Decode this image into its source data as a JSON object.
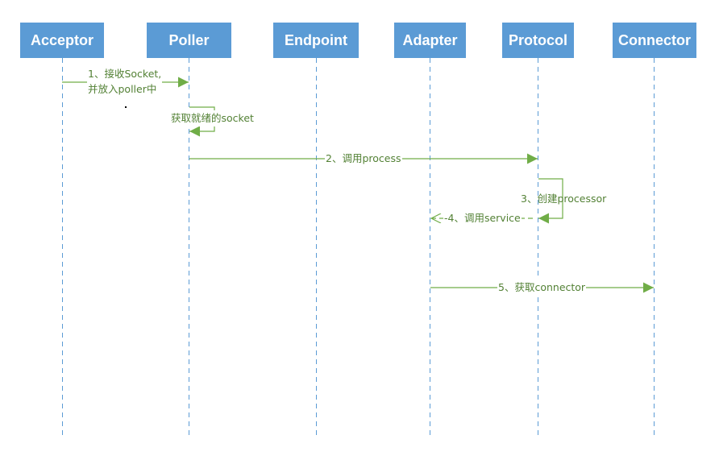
{
  "colors": {
    "box_fill": "#5b9bd5",
    "lifeline": "#5b9bd5",
    "message": "#70ad47",
    "label": "#538135"
  },
  "participants": [
    {
      "id": "acceptor",
      "label": "Acceptor"
    },
    {
      "id": "poller",
      "label": "Poller"
    },
    {
      "id": "endpoint",
      "label": "Endpoint"
    },
    {
      "id": "adapter",
      "label": "Adapter"
    },
    {
      "id": "protocol",
      "label": "Protocol"
    },
    {
      "id": "connector",
      "label": "Connector"
    }
  ],
  "messages": [
    {
      "from": "acceptor",
      "to": "poller",
      "label_line1": "1、接收Socket,",
      "label_line2": "并放入poller中",
      "type": "sync"
    },
    {
      "from": "poller",
      "to": "poller",
      "label": "获取就绪的socket",
      "type": "self"
    },
    {
      "from": "poller",
      "to": "protocol",
      "label": "2、调用process",
      "type": "sync"
    },
    {
      "from": "protocol",
      "to": "protocol",
      "label": "3、创建processor",
      "type": "self"
    },
    {
      "from": "protocol",
      "to": "adapter",
      "label": "-4、调用service",
      "type": "return"
    },
    {
      "from": "adapter",
      "to": "connector",
      "label": "5、获取connector",
      "type": "sync"
    }
  ]
}
